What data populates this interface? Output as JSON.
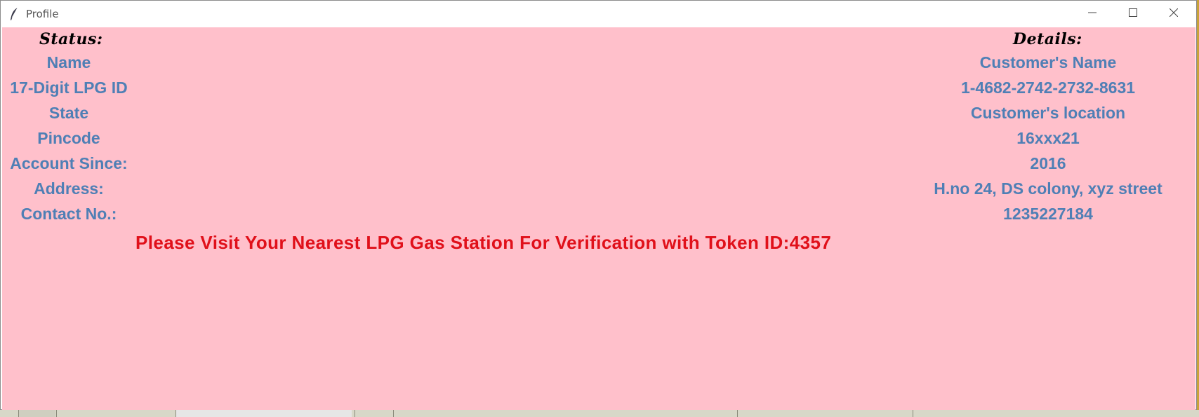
{
  "window": {
    "title": "Profile"
  },
  "headings": {
    "status": "Status:",
    "details": "Details:"
  },
  "rows": [
    {
      "label": "Name",
      "value": "Customer's Name"
    },
    {
      "label": "17-Digit LPG ID",
      "value": "1-4682-2742-2732-8631"
    },
    {
      "label": "State",
      "value": "Customer's location"
    },
    {
      "label": "Pincode",
      "value": "16xxx21"
    },
    {
      "label": "Account Since:",
      "value": "2016"
    },
    {
      "label": "Address:",
      "value": "H.no 24, DS colony, xyz street"
    },
    {
      "label": "Contact No.:",
      "value": "1235227184"
    }
  ],
  "notice": "Please Visit Your Nearest LPG Gas Station For Verification with Token ID:4357",
  "colors": {
    "background": "#ffc0cb",
    "label": "#4f7fb5",
    "notice": "#e0101a"
  },
  "icons": {
    "app": "feather-icon",
    "minimize": "minimize-icon",
    "maximize": "maximize-icon",
    "close": "close-icon"
  }
}
